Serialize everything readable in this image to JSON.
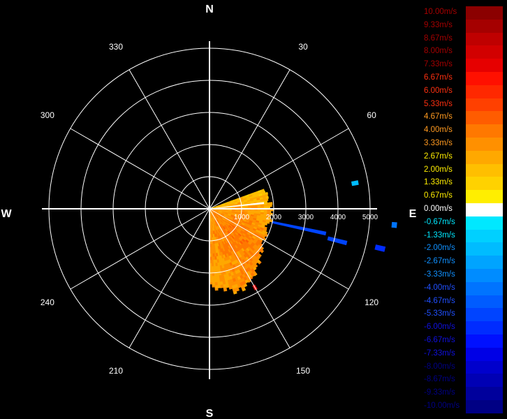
{
  "chart_data": {
    "type": "polar-heatmap",
    "title": "",
    "compass_labels": {
      "north": "N",
      "east": "E",
      "south": "S",
      "west": "W"
    },
    "azimuth_labels": [
      "30",
      "60",
      "120",
      "150",
      "210",
      "240",
      "300",
      "330"
    ],
    "azimuths": [
      30,
      60,
      120,
      150,
      210,
      240,
      300,
      330
    ],
    "range_labels": [
      "1000",
      "2000",
      "3000",
      "4000",
      "5000"
    ],
    "range_rings": [
      1000,
      2000,
      3000,
      4000,
      5000
    ],
    "range_max": 5000,
    "spoke_interval_deg": 30,
    "grid": true,
    "background": "#000000",
    "grid_color": "#ffffff",
    "legend_placement": "right",
    "colorbar": [
      {
        "label": "10.00m/s",
        "value": 10.0,
        "color": "#8b0000"
      },
      {
        "label": "9.33m/s",
        "value": 9.33,
        "color": "#a50000"
      },
      {
        "label": "8.67m/s",
        "value": 8.67,
        "color": "#bf0000"
      },
      {
        "label": "8.00m/s",
        "value": 8.0,
        "color": "#d20000"
      },
      {
        "label": "7.33m/s",
        "value": 7.33,
        "color": "#e60000"
      },
      {
        "label": "6.67m/s",
        "value": 6.67,
        "color": "#ff1000"
      },
      {
        "label": "6.00m/s",
        "value": 6.0,
        "color": "#ff2800"
      },
      {
        "label": "5.33m/s",
        "value": 5.33,
        "color": "#ff4000"
      },
      {
        "label": "4.67m/s",
        "value": 4.67,
        "color": "#ff5c00"
      },
      {
        "label": "4.00m/s",
        "value": 4.0,
        "color": "#ff7800"
      },
      {
        "label": "3.33m/s",
        "value": 3.33,
        "color": "#ff9000"
      },
      {
        "label": "2.67m/s",
        "value": 2.67,
        "color": "#ffa800"
      },
      {
        "label": "2.00m/s",
        "value": 2.0,
        "color": "#ffbf00"
      },
      {
        "label": "1.33m/s",
        "value": 1.33,
        "color": "#ffd200"
      },
      {
        "label": "0.67m/s",
        "value": 0.67,
        "color": "#ffee00"
      },
      {
        "label": "0.00m/s",
        "value": 0.0,
        "color": "#ffffff"
      },
      {
        "label": "-0.67m/s",
        "value": -0.67,
        "color": "#00e8ff"
      },
      {
        "label": "-1.33m/s",
        "value": -1.33,
        "color": "#00d0ff"
      },
      {
        "label": "-2.00m/s",
        "value": -2.0,
        "color": "#00bcff"
      },
      {
        "label": "-2.67m/s",
        "value": -2.67,
        "color": "#00a4ff"
      },
      {
        "label": "-3.33m/s",
        "value": -3.33,
        "color": "#008cff"
      },
      {
        "label": "-4.00m/s",
        "value": -4.0,
        "color": "#0074ff"
      },
      {
        "label": "-4.67m/s",
        "value": -4.67,
        "color": "#005cff"
      },
      {
        "label": "-5.33m/s",
        "value": -5.33,
        "color": "#0044ff"
      },
      {
        "label": "-6.00m/s",
        "value": -6.0,
        "color": "#002cff"
      },
      {
        "label": "-6.67m/s",
        "value": -6.67,
        "color": "#0010ff"
      },
      {
        "label": "-7.33m/s",
        "value": -7.33,
        "color": "#0000e6"
      },
      {
        "label": "-8.00m/s",
        "value": -8.0,
        "color": "#0000cc"
      },
      {
        "label": "-8.67m/s",
        "value": -8.67,
        "color": "#0000b4"
      },
      {
        "label": "-9.33m/s",
        "value": -9.33,
        "color": "#00009c"
      },
      {
        "label": "-10.00m/s",
        "value": -10.0,
        "color": "#000084"
      }
    ],
    "label_colors": {
      "positive_low": "#ffee00",
      "positive_high": "#a50000",
      "zero": "#ffffff",
      "negative_low": "#00e8ff",
      "negative_high": "#000084"
    },
    "echo_region": {
      "azimuth_bins": [
        70,
        80,
        90,
        100,
        110,
        120,
        130,
        140,
        150,
        160,
        170,
        180
      ],
      "max_range": [
        1800,
        1850,
        2000,
        1900,
        1850,
        1950,
        2100,
        2400,
        2650,
        2700,
        2550,
        2400
      ],
      "velocity": [
        1.8,
        2.3,
        2.6,
        3.0,
        3.2,
        3.4,
        3.6,
        3.5,
        3.4,
        3.2,
        3.0,
        2.9
      ]
    },
    "isolated_gates": [
      {
        "azimuth": 102,
        "range_start": 2000,
        "range_end": 3700,
        "velocity": -5.33
      },
      {
        "azimuth": 104,
        "range_start": 3800,
        "range_end": 4400,
        "velocity": -5.33
      },
      {
        "azimuth": 103,
        "range_start": 5300,
        "range_end": 5600,
        "velocity": -6.0
      },
      {
        "azimuth": 80,
        "range_start": 4500,
        "range_end": 4700,
        "velocity": -2.0
      },
      {
        "azimuth": 95,
        "range_start": 5700,
        "range_end": 5850,
        "velocity": -4.0
      },
      {
        "azimuth": 150,
        "range_start": 2750,
        "range_end": 2900,
        "velocity": 7.33
      },
      {
        "azimuth": 84,
        "range_start": 200,
        "range_end": 1700,
        "velocity": 0.0
      }
    ]
  }
}
